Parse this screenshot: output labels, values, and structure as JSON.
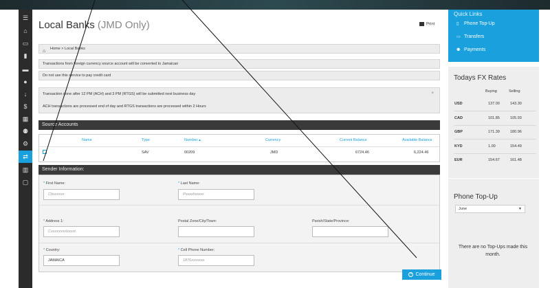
{
  "page": {
    "title": "Local Banks",
    "title_suffix": "(JMD Only)",
    "print_label": "Print",
    "breadcrumb": "Home > Local Banks"
  },
  "notices": {
    "n1": "Transactions from foreign currency source account will be converted to Jamaican",
    "n2": "Do not use this service to pay credit card",
    "n3_l1": "Transaction done after 12 PM (ACH) and 3 PM (RTGS) will be submitted next business day",
    "n3_l2": "ACH transactions are processed end of day and RTGS transactions are processed within 2 Hours",
    "close": "×"
  },
  "source_accounts": {
    "header": "Source Accounts",
    "columns": [
      "Name",
      "Type",
      "Number ▴",
      "Currency",
      "Current Balance",
      "Available Balance"
    ],
    "rows": [
      {
        "name": "",
        "type": "SAV",
        "number": "00209",
        "currency": "JMD",
        "current": "6724.46",
        "available": "6,224.46"
      }
    ]
  },
  "sender": {
    "header": "Sender Information:",
    "first_name_label": "First Name:",
    "first_name_value": "Cbsxxxxx",
    "last_name_label": "Last Name:",
    "last_name_value": "Pxxxxhxxxxr",
    "address_label": "Address 1:",
    "address_value": "Cxxxxxxxxlxxxxt.",
    "postal_label": "Postal Zone/City/Town:",
    "postal_value": "",
    "parish_label": "Parish/State/Province:",
    "parish_value": "",
    "country_label": "Country:",
    "country_value": "JAMAICA",
    "cell_label": "Cell Phone Number:",
    "cell_value": "1876xxxxxxx"
  },
  "continue_label": "Continue",
  "quick_links": {
    "title": "Quick Links",
    "items": [
      {
        "label": "Phone Top-Up",
        "icon": "phone-icon"
      },
      {
        "label": "Transfers",
        "icon": "monitor-icon"
      },
      {
        "label": "Payments",
        "icon": "users-icon"
      }
    ]
  },
  "fx": {
    "title": "Todays FX Rates",
    "buy_label": "Buying",
    "sell_label": "Selling",
    "rows": [
      {
        "cur": "USD",
        "buy": "137.00",
        "sell": "143.30"
      },
      {
        "cur": "CAD",
        "buy": "101.85",
        "sell": "105.93"
      },
      {
        "cur": "GBP",
        "buy": "171.39",
        "sell": "180.96"
      },
      {
        "cur": "KYD",
        "buy": "1.00",
        "sell": "154.49"
      },
      {
        "cur": "EUR",
        "buy": "154.67",
        "sell": "161.48"
      }
    ]
  },
  "phone_topup": {
    "title": "Phone Top-Up",
    "select_value": "June",
    "empty_text": "There are no Top-Ups made this month."
  },
  "sidebar_icons": [
    "menu-icon",
    "home-icon",
    "monitor-icon",
    "device-icon",
    "card-icon",
    "user-icon",
    "download-icon",
    "money-icon",
    "calculator-icon",
    "users-icon",
    "gear-icon",
    "transfer-icon",
    "bank-icon",
    "chat-icon"
  ]
}
